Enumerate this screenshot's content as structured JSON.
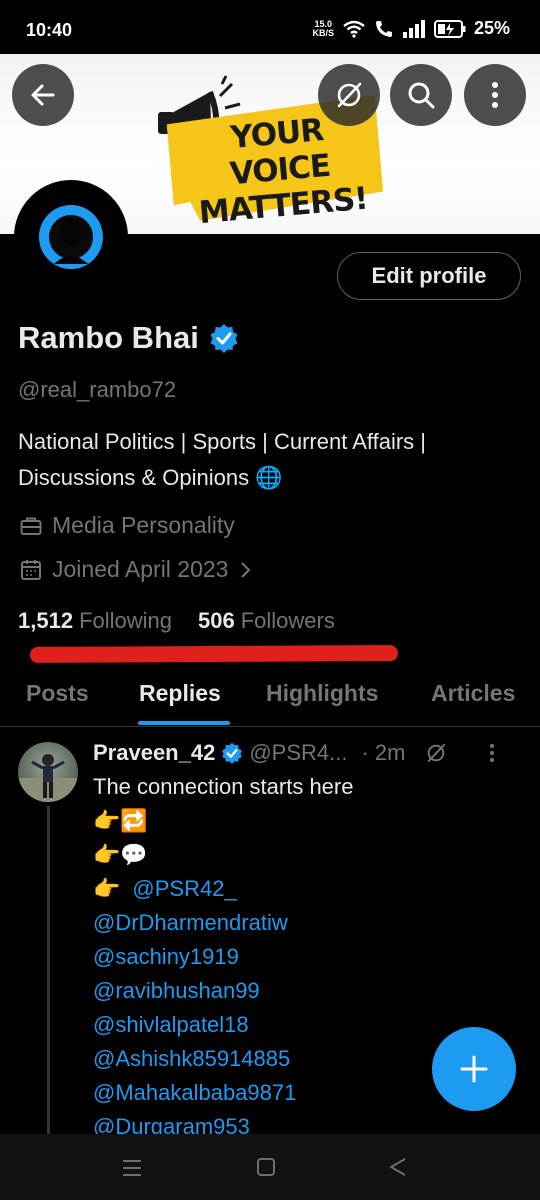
{
  "status_bar": {
    "time": "10:40",
    "speed": "15.0",
    "speed_unit": "KB/S",
    "battery": "25%"
  },
  "banner": {
    "line1": "YOUR VOICE",
    "line2": "MATTERS!"
  },
  "header_buttons": {
    "back_icon": "arrow-left-icon",
    "grok_icon": "slashed-circle-icon",
    "search_icon": "search-icon",
    "more_icon": "more-vertical-icon"
  },
  "profile": {
    "edit_label": "Edit profile",
    "name": "Rambo Bhai",
    "handle": "@real_rambo72",
    "bio_line1": "National Politics | Sports | Current Affairs |",
    "bio_line2": "Discussions & Opinions 🌐",
    "category": "Media Personality",
    "joined": "Joined April 2023",
    "following_count": "1,512",
    "following_label": "Following",
    "followers_count": "506",
    "followers_label": "Followers"
  },
  "tabs": [
    {
      "label": "Posts"
    },
    {
      "label": "Replies"
    },
    {
      "label": "Highlights"
    },
    {
      "label": "Articles"
    }
  ],
  "tweet": {
    "author": "Praveen_42",
    "handle": "@PSR4...",
    "time": "· 2m",
    "text": "The connection starts here",
    "emoji_line1": "👉🔁",
    "emoji_line2": "👉💬",
    "emoji_line3": "👉",
    "mentions": [
      "@PSR42_",
      "@DrDharmendratiw",
      "@sachiny1919",
      "@ravibhushan99",
      "@shivlalpatel18",
      "@Ashishk85914885",
      "@Mahakalbaba9871",
      "@Durgaram953"
    ]
  },
  "colors": {
    "accent": "#1d9bf0",
    "banner_yellow": "#f5c518",
    "underline_red": "#e0211b"
  }
}
